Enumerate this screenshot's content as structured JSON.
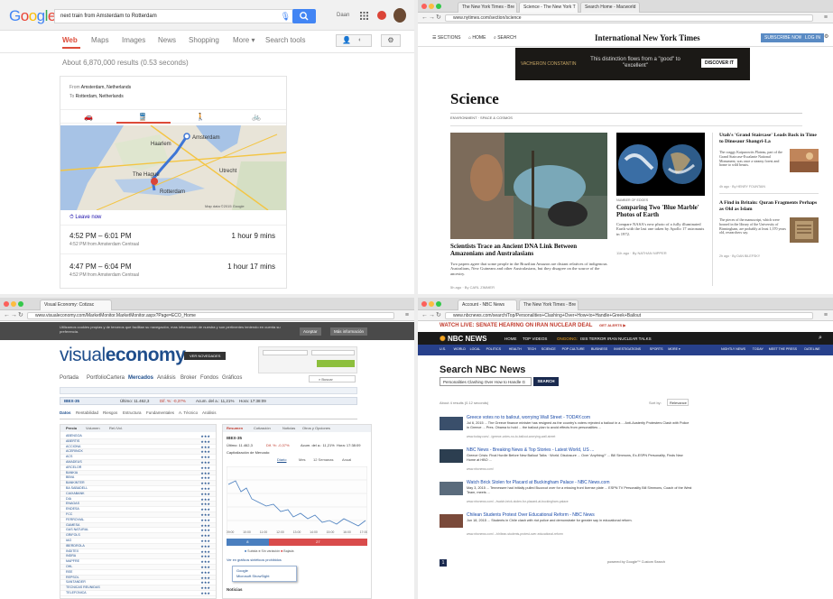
{
  "google": {
    "logo": "Google",
    "query": "next train from Amsterdam to Rotterdam",
    "search_label": "Search",
    "user": "Daan",
    "tabs": [
      "Web",
      "Maps",
      "Images",
      "News",
      "Shopping",
      "More ▾",
      "Search tools"
    ],
    "results_count": "About 6,870,000 results (0.53 seconds)",
    "from_label": "From",
    "from": "Amsterdam, Netherlands",
    "to_label": "To",
    "to": "Rotterdam, Netherlands",
    "map_labels": [
      "Amsterdam",
      "The Hague",
      "Rotterdam",
      "Utrecht",
      "Haarlem"
    ],
    "map_credit": "Map data ©2015 Google",
    "leave_now": "Leave now",
    "trips": [
      {
        "time": "4:52 PM – 6:01 PM",
        "detail": "4:52 PM from Amsterdam Centraal",
        "duration": "1 hour 9 mins"
      },
      {
        "time": "4:47 PM – 6:04 PM",
        "detail": "4:52 PM from Amsterdam Centraal",
        "duration": "1 hour 17 mins"
      }
    ]
  },
  "nyt": {
    "tabs": [
      "The New York Times - Bre",
      "Science - The New York T",
      "Search Home - Macworld"
    ],
    "url": "www.nytimes.com/section/science",
    "sections": "SECTIONS",
    "home": "HOME",
    "search": "SEARCH",
    "masthead": "International New York Times",
    "subscribe": "SUBSCRIBE NOW",
    "login": "LOG IN",
    "ad_text": "This distinction flows from a \"good\" to \"excellent\"",
    "ad_brand": "VACHERON CONSTANTIN",
    "ad_button": "DISCOVER IT",
    "section_title": "Science",
    "subsections": "ENVIRONMENT · SPACE & COSMOS",
    "main_headline": "Scientists Trace an Ancient DNA Link Between Amazonians and Australasians",
    "main_summary": "Two papers agree that some people in the Brazilian Amazon are distant relatives of indigenous Australians, New Guineans and other Australasians, but they disagree on the source of the ancestry.",
    "main_byline": "5h ago · By CARL ZIMMER",
    "mid_kicker": "NUMBER OF EDGES",
    "mid_headline": "Comparing Two 'Blue Marble' Photos of Earth",
    "mid_summary": "Compare NASA's new photo of a fully illuminated Earth with the last one taken by Apollo 17 astronauts in 1972.",
    "mid_byline": "11h ago · By NATHAN NIPPER",
    "r1_headline": "Utah's 'Grand Staircase' Leads Back in Time to Dinosaur Shangri-La",
    "r1_summary": "The craggy Kaiparowits Plateau, part of the Grand Staircase-Escalante National Monument, was once a steamy forest and home to wild beasts.",
    "r1_byline": "4h ago · By HENRY FOUNTAIN",
    "r2_headline": "A Find in Britain: Quran Fragments Perhaps as Old as Islam",
    "r2_summary": "The pieces of the manuscript, which were housed in the library of the University of Birmingham, are probably at least 1,370 years old, researchers say.",
    "r2_byline": "2h ago · By DAN BILEFSKY"
  },
  "ve": {
    "tab": "Visual Economy: Cotizac",
    "url": "www.visualeconomy.com/MarketMonitor.MarketMonitor.aspx?Page=ECO_Home",
    "cookie": "Utilizamos cookies propias y de terceros que facilitan su navegación, mas información de nuestra y son pertinentes teniendo en cuenta su preferencia.",
    "accept": "Aceptar",
    "more_info": "Más información",
    "logo_a": "visual",
    "logo_b": "economy",
    "news_badge": "VER NOVEDADES",
    "menu": [
      "Portada",
      "Portfolio",
      "Cartera",
      "Mercados",
      "Análisis",
      "Broker",
      "Fondos",
      "Gráficos"
    ],
    "search_btn": "Buscar",
    "tabs": [
      "Datos",
      "Rentabilidad",
      "Riesgos",
      "Estructura",
      "Fundamentales",
      "A. Técnico",
      "Análisis"
    ],
    "subtabs": [
      "Precio",
      "Volumen",
      "Rel./Vol."
    ],
    "right_tabs": [
      "Resumen",
      "Cotización",
      "Noticias",
      "Otros y Opciones"
    ],
    "ticker_title": "IBEX-35",
    "quote_line": [
      "Último: 11.462,3",
      "Dif. %: -0,37%",
      "Acum. del a.: 11,21%",
      "Hora: 17:38:09"
    ],
    "cap_label": "Capitalización de Mercado:",
    "period_tabs": [
      "Diario",
      "Mes",
      "12 Semanas",
      "Anual"
    ],
    "legend": [
      "Subida",
      "Sin variación",
      "Bajada"
    ],
    "bar_left": "8",
    "bar_right": "27",
    "graph_link": "Ver en gráficos sintéticos prohibidos",
    "tooltip_a": "Google",
    "tooltip_b": "Microsoft ShowSight",
    "rows": [
      "ABENGOA",
      "ABERTIS",
      "ACCIONA",
      "ACERINOX",
      "ACS",
      "AMADEUS",
      "ARCELOR",
      "BANKIA",
      "BBVA",
      "BANKINTER",
      "BA SABADELL",
      "CAIXABANK",
      "DIA",
      "ENAGAS",
      "ENDESA",
      "FCC",
      "FERROVIAL",
      "GAMESA",
      "GAS NATURAL",
      "GRIFOLS",
      "IAG",
      "IBERDROLA",
      "INDITEX",
      "INDRA",
      "MAPFRE",
      "OHL",
      "REE",
      "REPSOL",
      "SANTANDER",
      "TECNICAS REUNIDAS",
      "TELEFONICA"
    ],
    "x_ticks": [
      "09:00",
      "10:00",
      "11:00",
      "12:00",
      "13:00",
      "14:00",
      "15:00",
      "16:00",
      "17:00"
    ],
    "chart_head": "Noticias"
  },
  "nbc": {
    "tabs": [
      "Account - NBC News",
      "The New York Times - Bre"
    ],
    "url": "www.nbcnews.com/search/Top/Personalities+Clashing+Over+How+to+Handle+Greek+Bailout",
    "alert": "WATCH LIVE: SENATE HEARING ON IRAN NUCLEAR DEAL",
    "alert_b": "GET ALERTS ▶",
    "logo": "NBC NEWS",
    "nav1": [
      "HOME",
      "TOP VIDEOS",
      "ONGOING:",
      "ISIS TERROR",
      "IRAN NUCLEAR TALKS"
    ],
    "nav2": [
      "U.S.",
      "WORLD",
      "LOCAL",
      "POLITICS",
      "HEALTH",
      "TECH",
      "SCIENCE",
      "POP CULTURE",
      "BUSINESS",
      "INVESTIGATIONS",
      "SPORTS",
      "MORE ▾"
    ],
    "nav2_right": [
      "NIGHTLY NEWS",
      "TODAY",
      "MEET THE PRESS",
      "DATELINE"
    ],
    "search_title": "Search NBC News",
    "search_value": "Personalities Clashing Over How to Handle G",
    "search_btn": "SEARCH",
    "results_meta": "About 4 results (0.12 seconds)",
    "sort_label": "Sort by:",
    "sort_value": "Relevance",
    "results": [
      {
        "title": "Greece votes no to bailout, worrying Wall Street - TODAY.com",
        "desc": "Jul 6, 2015 ... The Greece finance minister has resigned as the country's voters rejected a bailout in a ... Anti-Austerity Protesters Clash with Police in Greece ... Pres. Obama to hold ... the bailout plan to avoid effects from personalities ...",
        "url": "www.today.com/.../greece-votes-no-to-bailout-worrying-wall-street"
      },
      {
        "title": "NBC News - Breaking News & Top Stories - Latest World, US ...",
        "desc": "Greece Crisis: Final Hurdle Before New Bailout Talks · World. Disclosure ... Over 'Anything?' ... Bill Simmons, Ex-ESPN Personality, Finds New Home at HBO ...",
        "url": "www.nbcnews.com/"
      },
      {
        "title": "Watch Brick Stolen for Placard at Buckingham Palace - NBC News.com",
        "desc": "May 3, 2015 ... Tennessee had initially pulled Buzzcut over for a missing front license plate ... ESPN TV Personality Bill Simmons, Coach of the West Team, meets ...",
        "url": "www.nbcnews.com/.../watch-brick-stolen-for-placard-at-buckingham-palace"
      },
      {
        "title": "Chilean Students Protest Over Educational Reform - NBC News",
        "desc": "Jun 18, 2015 ... Students in Chile clash with riot police and demonstrate for greater say in educational reform.",
        "url": "www.nbcnews.com/.../chilean-students-protest-over-educational-reform"
      }
    ],
    "page_num": "1",
    "powered": "powered by Google™ Custom Search"
  }
}
